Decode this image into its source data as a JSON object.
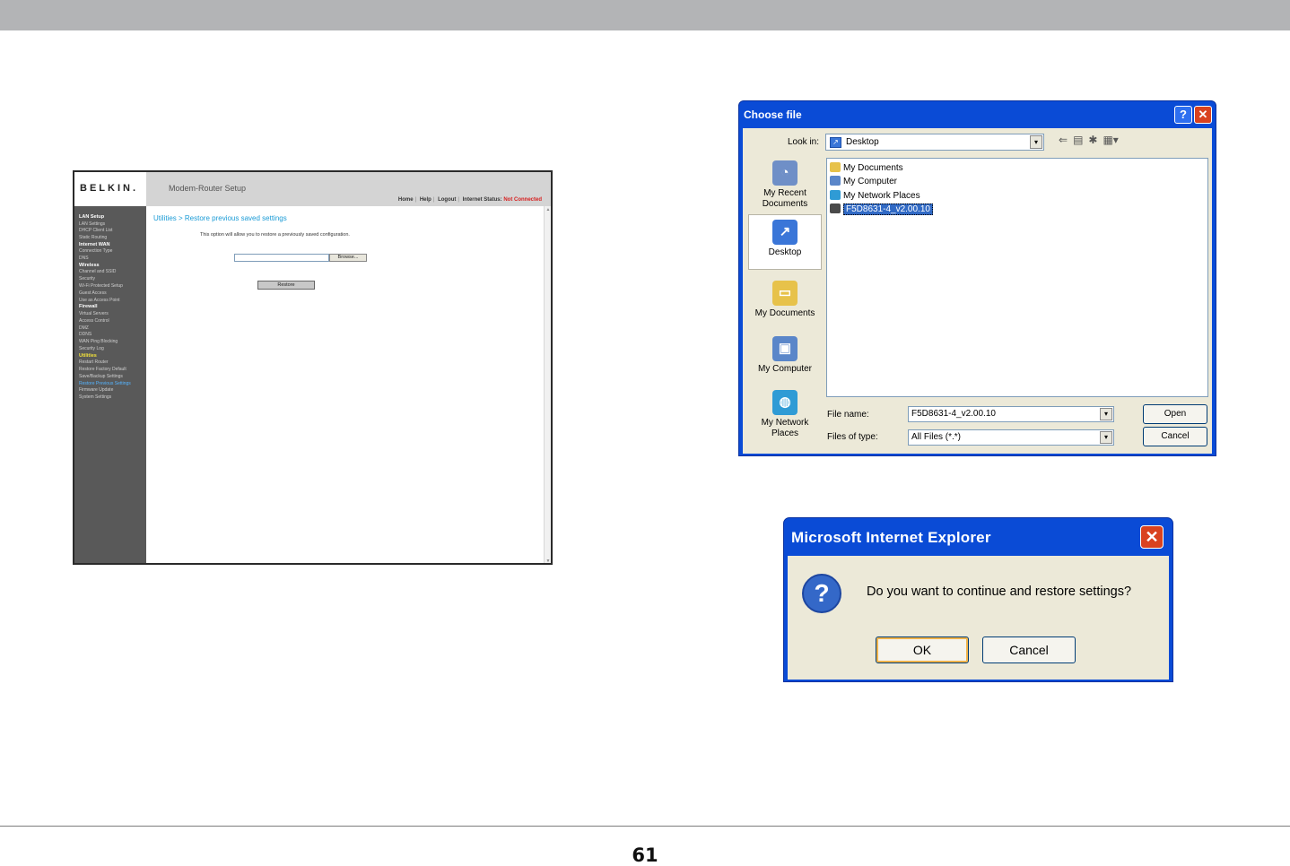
{
  "page_number": "61",
  "belkin": {
    "logo": "BELKIN.",
    "title": "Modem-Router Setup",
    "top_links": [
      "Home",
      "Help",
      "Logout"
    ],
    "status_label": "Internet Status:",
    "status_value": "Not Connected",
    "breadcrumb": "Utilities > Restore previous saved settings",
    "description": "This option will allow you to restore a previously saved configuration.",
    "browse_label": "Browse...",
    "restore_label": "Restore",
    "sidebar": {
      "lan_setup": "LAN Setup",
      "lan_items": [
        "LAN Settings",
        "DHCP Client List",
        "Static Routing"
      ],
      "internet_wan": "Internet WAN",
      "wan_items": [
        "Connection Type",
        "DNS"
      ],
      "wireless": "Wireless",
      "wireless_items": [
        "Channel and SSID",
        "Security",
        "Wi-Fi Protected Setup",
        "Guest Access",
        "Use as Access Point"
      ],
      "firewall": "Firewall",
      "firewall_items": [
        "Virtual Servers",
        "Access Control",
        "DMZ",
        "DDNS",
        "WAN Ping Blocking",
        "Security Log"
      ],
      "utilities": "Utilities",
      "utilities_items": [
        "Restart Router",
        "Restore Factory Default",
        "Save/Backup Settings",
        "Restore Previous Settings",
        "Firmware Update",
        "System Settings"
      ]
    }
  },
  "choose_file": {
    "title": "Choose file",
    "look_in_label": "Look in:",
    "look_in_value": "Desktop",
    "places": [
      {
        "label": "My Recent Documents"
      },
      {
        "label": "Desktop"
      },
      {
        "label": "My Documents"
      },
      {
        "label": "My Computer"
      },
      {
        "label": "My Network Places"
      }
    ],
    "files": [
      "My Documents",
      "My Computer",
      "My Network Places",
      "F5D8631-4_v2.00.10"
    ],
    "file_name_label": "File name:",
    "file_name_value": "F5D8631-4_v2.00.10",
    "files_of_type_label": "Files of type:",
    "files_of_type_value": "All Files (*.*)",
    "open_label": "Open",
    "cancel_label": "Cancel"
  },
  "ie_dialog": {
    "title": "Microsoft Internet Explorer",
    "message": "Do you want to continue and restore settings?",
    "ok_label": "OK",
    "cancel_label": "Cancel"
  }
}
